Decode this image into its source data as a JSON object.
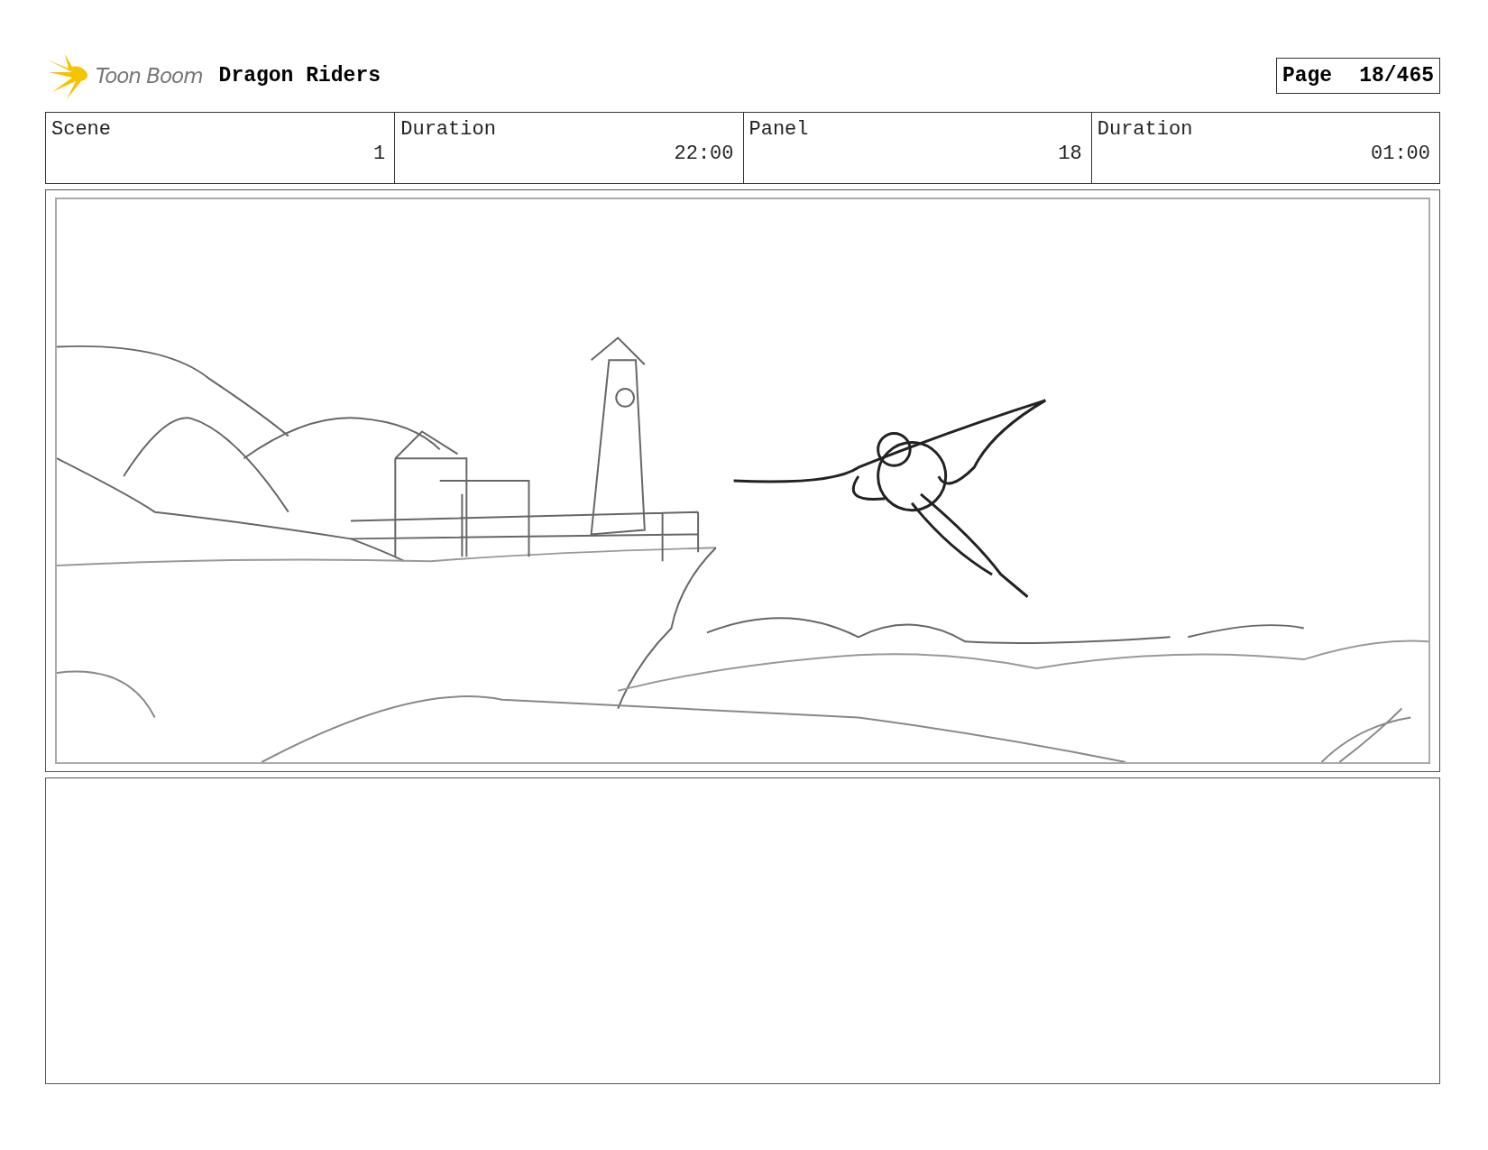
{
  "header": {
    "logo_text": "Toon Boom",
    "title": "Dragon Riders",
    "page_label": "Page",
    "page_number": "18/465"
  },
  "info_table": {
    "columns": [
      "Scene",
      "Duration",
      "Panel",
      "Duration"
    ],
    "rows": [
      [
        "1",
        "22:00",
        "18",
        "01:00"
      ]
    ]
  }
}
